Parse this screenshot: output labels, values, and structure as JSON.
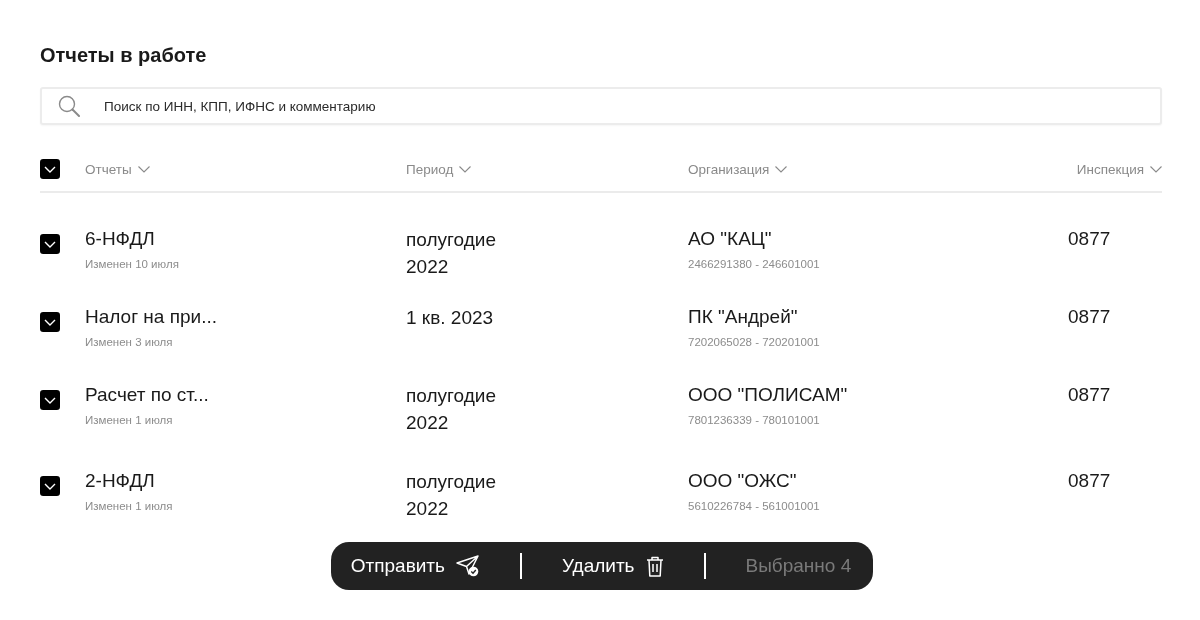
{
  "title": "Отчеты в работе",
  "search": {
    "placeholder": "Поиск по ИНН, КПП, ИФНС и комментарию"
  },
  "table": {
    "select_all": {
      "checked": true
    },
    "columns": [
      {
        "label": "Отчеты"
      },
      {
        "label": "Период"
      },
      {
        "label": "Организация"
      },
      {
        "label": "Инспекция"
      }
    ],
    "rows": [
      {
        "checked": true,
        "report": "6-НФДЛ",
        "modified": "Изменен 10 июля",
        "period": "полугодие 2022",
        "organization": "АО \"КАЦ\"",
        "codes": "2466291380 - 246601001",
        "inspection": "0877"
      },
      {
        "checked": true,
        "report": "Налог на при...",
        "modified": "Изменен 3 июля",
        "period": "1 кв. 2023",
        "organization": "ПК \"Андрей\"",
        "codes": "7202065028 - 720201001",
        "inspection": "0877"
      },
      {
        "checked": true,
        "report": "Расчет по ст...",
        "modified": "Изменен 1 июля",
        "period": "полугодие 2022",
        "organization": "ООО \"ПОЛИСАМ\"",
        "codes": "7801236339 - 780101001",
        "inspection": "0877"
      },
      {
        "checked": true,
        "report": "2-НФДЛ",
        "modified": "Изменен 1 июля",
        "period": "полугодие 2022",
        "organization": "ООО \"ОЖС\"",
        "codes": "5610226784 - 561001001",
        "inspection": "0877"
      }
    ]
  },
  "action_bar": {
    "send_label": "Отправить",
    "delete_label": "Удалить",
    "selected_count": "Выбранно 4"
  }
}
